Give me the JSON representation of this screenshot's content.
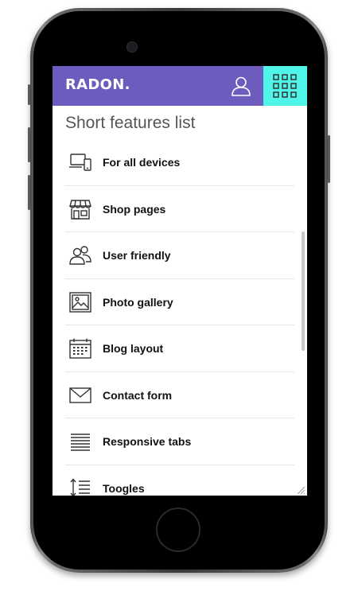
{
  "header": {
    "logo": "RADON.",
    "user_icon": "user-icon",
    "menu_icon": "grid-menu-icon",
    "header_color": "#6d5bbd",
    "menu_color": "#4ef5e8"
  },
  "main": {
    "title": "Short features list",
    "features": [
      {
        "label": "For all devices",
        "icon": "devices-icon"
      },
      {
        "label": "Shop pages",
        "icon": "shop-icon"
      },
      {
        "label": "User friendly",
        "icon": "users-icon"
      },
      {
        "label": "Photo gallery",
        "icon": "photo-icon"
      },
      {
        "label": "Blog layout",
        "icon": "calendar-icon"
      },
      {
        "label": "Contact form",
        "icon": "envelope-icon"
      },
      {
        "label": "Responsive tabs",
        "icon": "lines-icon"
      },
      {
        "label": "Toogles",
        "icon": "toggle-list-icon"
      }
    ]
  }
}
